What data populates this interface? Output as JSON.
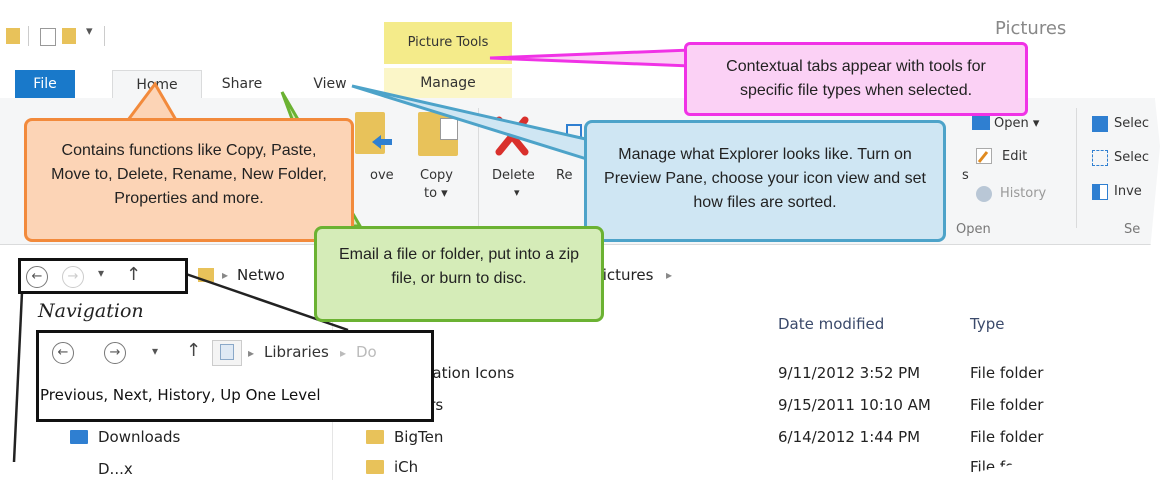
{
  "window": {
    "title": "Pictures"
  },
  "ribbon": {
    "contextual_group": "Picture Tools",
    "tabs": [
      "File",
      "Home",
      "Share",
      "View",
      "Manage"
    ],
    "buttons": {
      "move_to": "ove",
      "copy_to_line1": "Copy",
      "copy_to_line2": "to ▾",
      "delete": "Delete",
      "rename": "Re",
      "open": "Open ▾",
      "edit": "Edit",
      "history": "History",
      "open_group": "Open",
      "select_all": "Selec",
      "select_none": "Selec",
      "invert": "Inve",
      "select_group": "Se"
    }
  },
  "callouts": {
    "contextual": "Contextual tabs appear with tools for specific file types when selected.",
    "home": "Contains functions like Copy, Paste, Move to, Delete, Rename, New Folder, Properties and more.",
    "view": "Manage what Explorer looks like. Turn on Preview Pane, choose your icon view and set how files are sorted.",
    "share": "Email a file or folder, put into a zip file, or burn to disc.",
    "navigation_title": "Navigation",
    "navigation_caption": "Previous, Next, History, Up One Level"
  },
  "address": {
    "crumb_network": "Netwo",
    "crumb_pictures": "Pictures",
    "zoom_crumb_libraries": "Libraries",
    "zoom_crumb_next": "Do"
  },
  "columns": {
    "date_modified": "Date modified",
    "type": "Type"
  },
  "sidebar": {
    "downloads": "Downloads",
    "partial_item": "D...x"
  },
  "files": [
    {
      "name": "ication Icons",
      "date": "9/11/2012 3:52 PM",
      "type": "File folder"
    },
    {
      "name": "ars",
      "date": "9/15/2011 10:10 AM",
      "type": "File folder"
    },
    {
      "name": "BigTen",
      "date": "6/14/2012 1:44 PM",
      "type": "File folder"
    },
    {
      "name": "iCh",
      "date": "",
      "type": "File fo"
    }
  ],
  "colors": {
    "file_tab": "#1979ca",
    "picture_tools": "#f4eb8a",
    "callout_orange_fill": "#fcd4b6",
    "callout_orange_border": "#f28a3c",
    "callout_blue_fill": "#cfe6f3",
    "callout_blue_border": "#4da3c9",
    "callout_green_fill": "#d5ecb8",
    "callout_green_border": "#6bb232",
    "callout_pink_fill": "#fbd1f5",
    "callout_pink_border": "#f032e6"
  }
}
